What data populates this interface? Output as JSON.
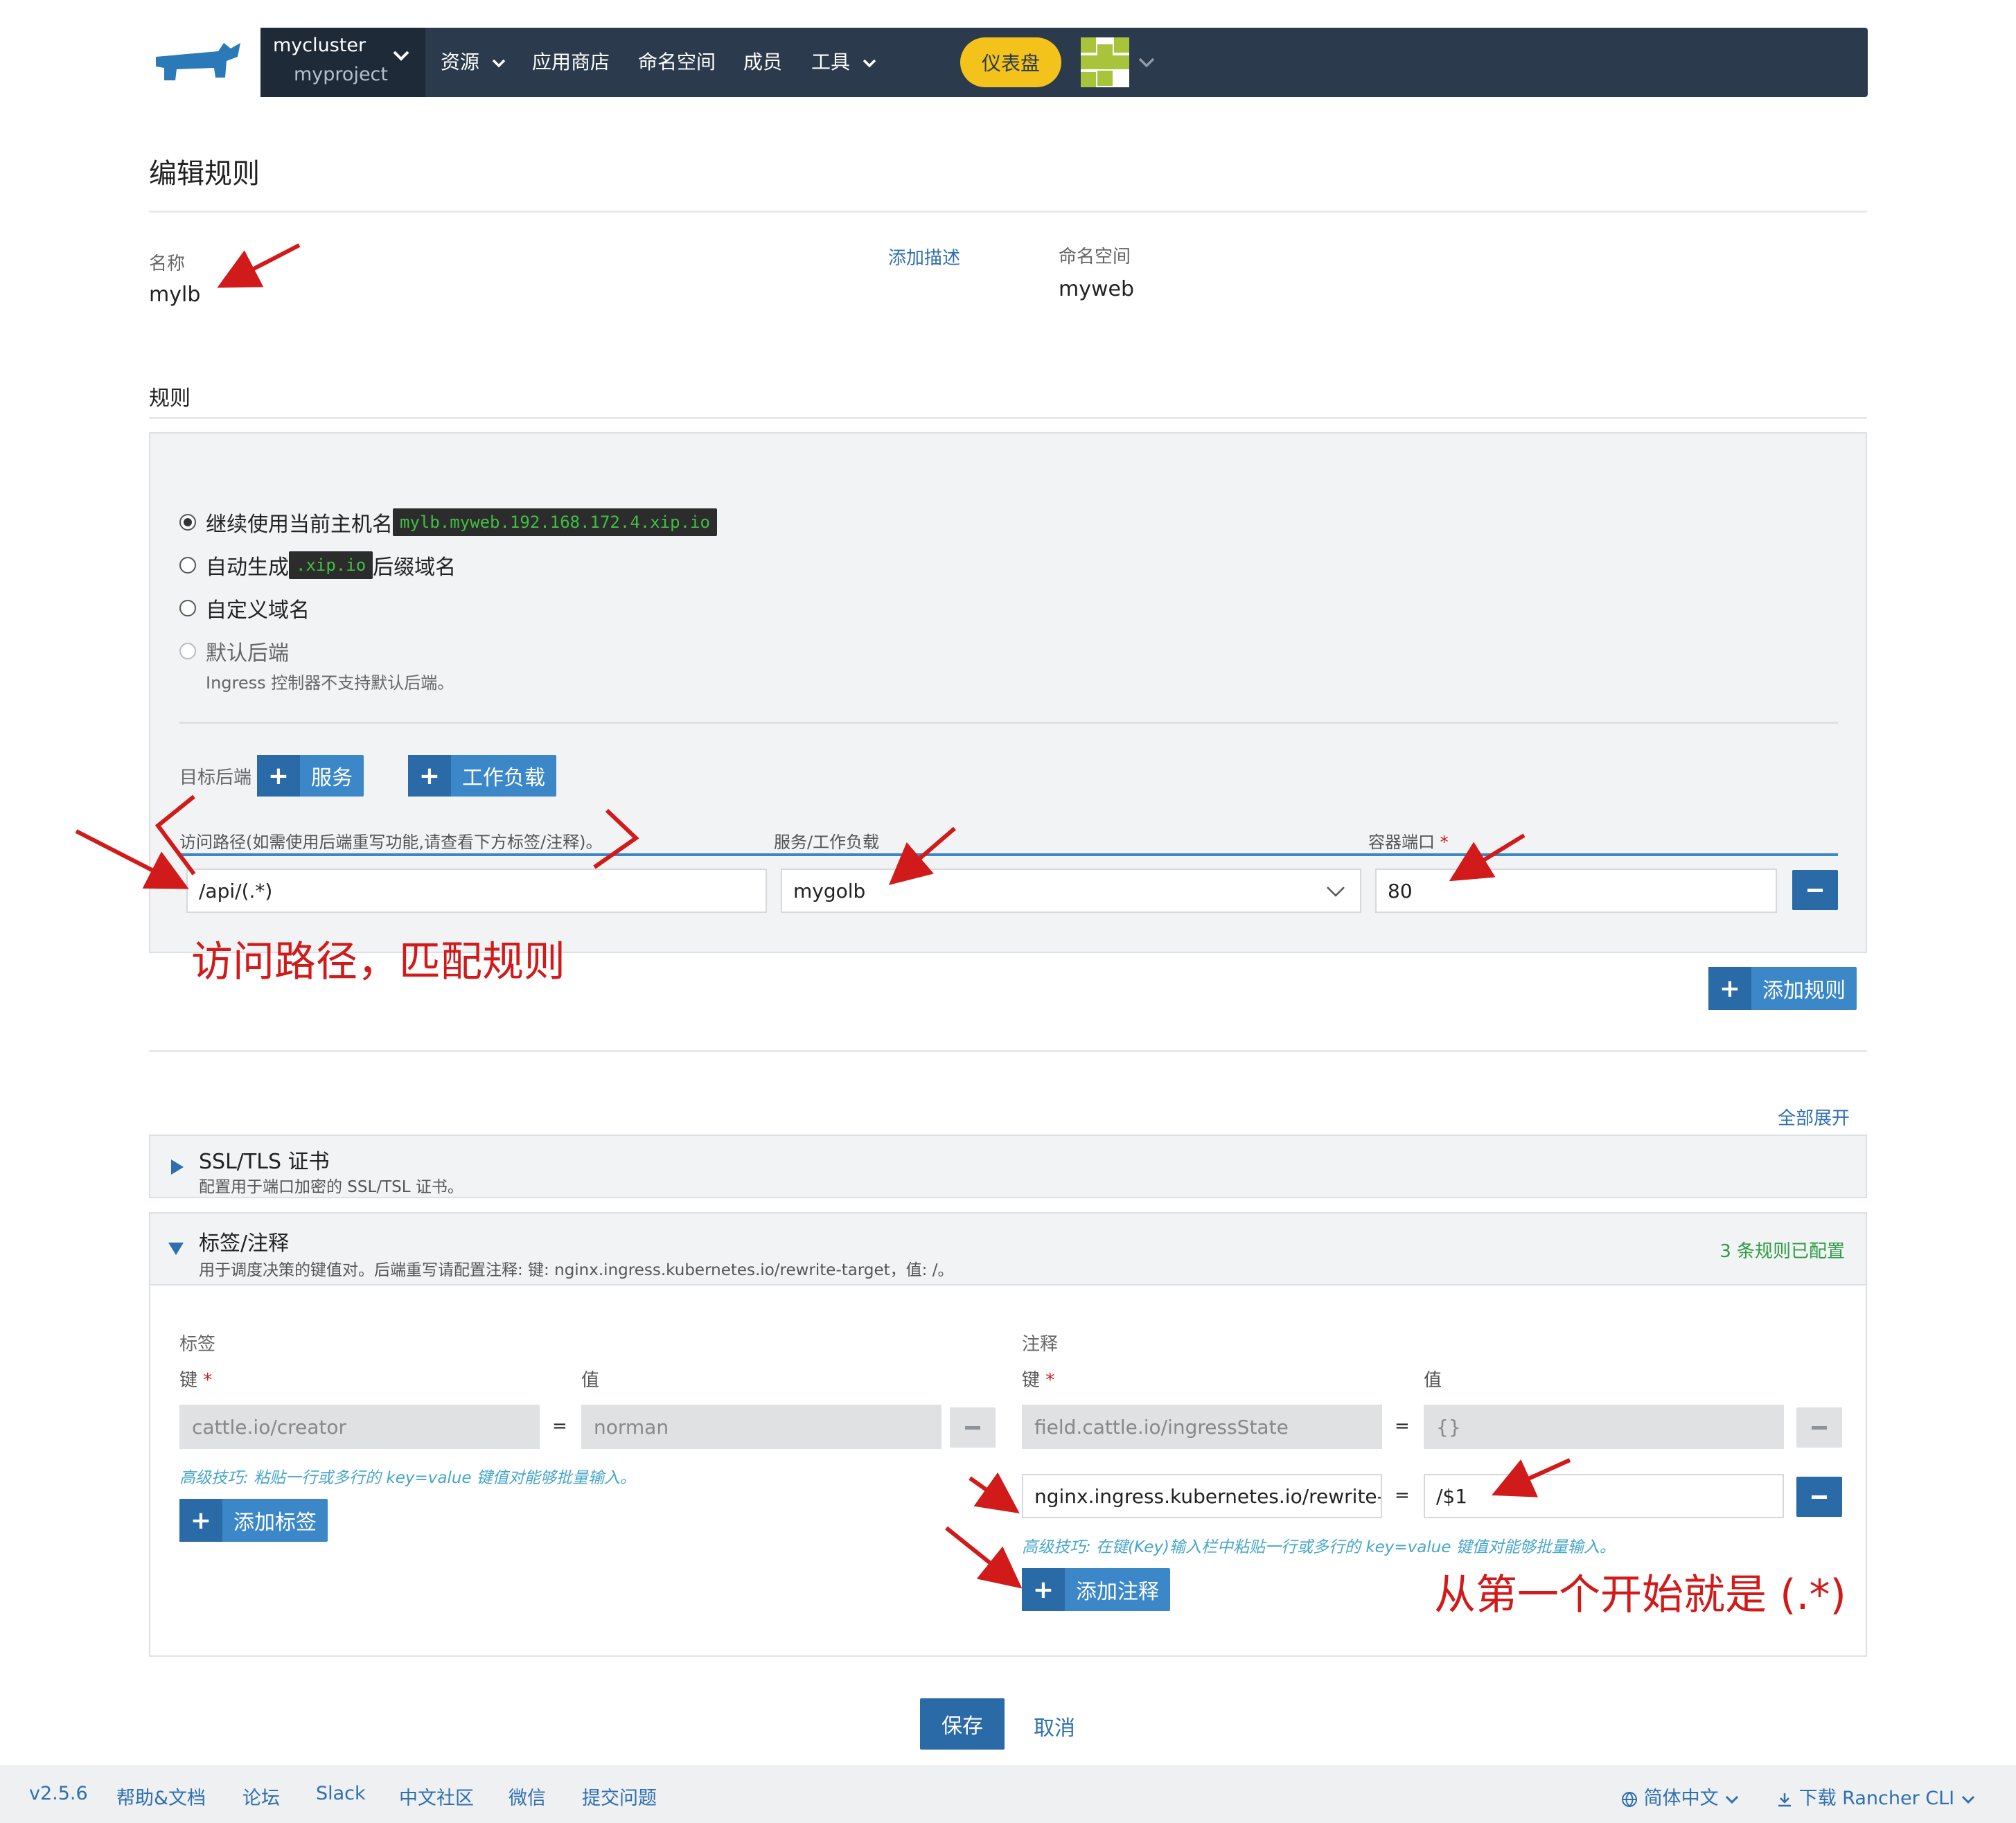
{
  "header": {
    "cluster": "mycluster",
    "project": "myproject",
    "nav": [
      "资源",
      "应用商店",
      "命名空间",
      "成员",
      "工具"
    ],
    "dashboard": "仪表盘"
  },
  "page": {
    "title": "编辑规则",
    "name_label": "名称",
    "name_value": "mylb",
    "add_description": "添加描述",
    "namespace_label": "命名空间",
    "namespace_value": "myweb",
    "rules_heading": "规则"
  },
  "rules": {
    "radio_keep": "继续使用当前主机名",
    "hostname": "mylb.myweb.192.168.172.4.xip.io",
    "radio_auto_prefix": "自动生成",
    "auto_code": ".xip.io",
    "radio_auto_suffix": "后缀域名",
    "radio_custom": "自定义域名",
    "radio_default": "默认后端",
    "default_note": "Ingress 控制器不支持默认后端。",
    "target_label": "目标后端",
    "btn_service": "服务",
    "btn_workload": "工作负载",
    "col_path": "访问路径(如需使用后端重写功能,请查看下方标签/注释)。",
    "col_target": "服务/工作负载",
    "col_port": "容器端口",
    "required": "*",
    "path_value": "/api/(.*)",
    "target_value": "mygolb",
    "port_value": "80",
    "add_rule": "添加规则"
  },
  "annotations_red": {
    "path_note": "访问路径，匹配规则",
    "regex_note": "从第一个开始就是 (.*)"
  },
  "expand_all": "全部展开",
  "ssl": {
    "title": "SSL/TLS 证书",
    "desc": "配置用于端口加密的 SSL/TSL 证书。"
  },
  "labels": {
    "title": "标签/注释",
    "desc": "用于调度决策的键值对。后端重写请配置注释: 键: nginx.ingress.kubernetes.io/rewrite-target，值: /。",
    "count": "3 条规则已配置",
    "labels_heading": "标签",
    "annotations_heading": "注释",
    "key": "键",
    "value": "值",
    "eq": "=",
    "label_key": "cattle.io/creator",
    "label_value": "norman",
    "label_tip": "高级技巧: 粘贴一行或多行的 key=value 键值对能够批量输入。",
    "add_label": "添加标签",
    "ann1_key": "field.cattle.io/ingressState",
    "ann1_value": "{}",
    "ann2_key": "nginx.ingress.kubernetes.io/rewrite-target",
    "ann2_value": "/$1",
    "ann_tip": "高级技巧: 在键(Key)输入栏中粘贴一行或多行的 key=value 键值对能够批量输入。",
    "add_annotation": "添加注释"
  },
  "actions": {
    "save": "保存",
    "cancel": "取消"
  },
  "footer": {
    "version": "v2.5.6",
    "links": [
      "帮助&文档",
      "论坛",
      "Slack",
      "中文社区",
      "微信",
      "提交问题"
    ],
    "language": "简体中文",
    "download": "下载 Rancher CLI"
  },
  "colors": {
    "header_bg": "#2b3a4c",
    "accent_blue": "#3b87c8",
    "dashboard_yellow": "#f3c21b",
    "annotation_red": "#d11a1a",
    "success_green": "#2e9b46"
  }
}
